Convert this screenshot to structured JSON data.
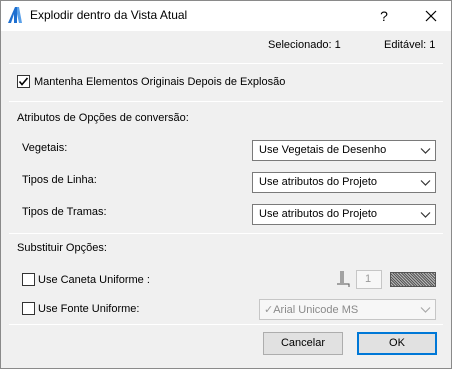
{
  "window": {
    "title": "Explodir dentro da Vista Atual",
    "help_label": "?"
  },
  "info": {
    "selected": "Selecionado: 1",
    "editable": "Editável: 1"
  },
  "keep_originals": {
    "label": "Mantenha Elementos Originais Depois de Explosão",
    "checked": true
  },
  "conversion": {
    "heading": "Atributos de Opções de conversão:",
    "rows": [
      {
        "label": "Vegetais:",
        "value": "Use Vegetais de Desenho"
      },
      {
        "label": "Tipos de Linha:",
        "value": "Use atributos do Projeto"
      },
      {
        "label": "Tipos de Tramas:",
        "value": "Use atributos do Projeto"
      }
    ]
  },
  "override": {
    "heading": "Substituir Opções:",
    "uniform_pen": {
      "label": "Use Caneta Uniforme :",
      "checked": false,
      "pen_number": "1"
    },
    "uniform_font": {
      "label": "Use Fonte Uniforme:",
      "checked": false,
      "font": "Arial Unicode MS"
    }
  },
  "buttons": {
    "cancel": "Cancelar",
    "ok": "OK"
  },
  "colors": {
    "accent": "#0078d7",
    "border": "#7a7a7a",
    "background": "#f0f0f0"
  }
}
